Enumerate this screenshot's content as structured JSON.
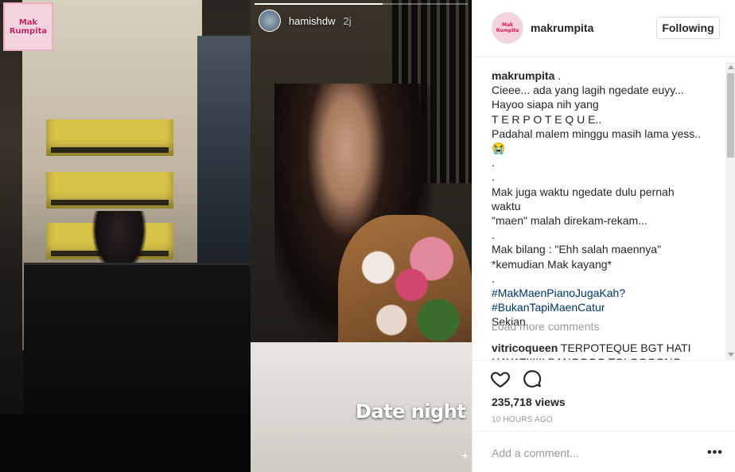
{
  "stories": {
    "logo_line1": "Mak",
    "logo_line2": "Rumpita",
    "story_username": "hamishdw",
    "story_time": "2j",
    "overlay_text": "Date night",
    "progress_fraction": 0.6,
    "plus_glyph": "+"
  },
  "post": {
    "header": {
      "username": "makrumpita",
      "follow_label": "Following"
    },
    "caption": {
      "author": "makrumpita",
      "lines": [
        ".",
        "Cieee... ada yang lagih ngedate euyy...",
        "Hayoo siapa nih yang",
        "T E R P O T E Q U E..",
        "Padahal malem minggu masih lama yess..",
        "😭",
        ".",
        ".",
        "Mak juga waktu ngedate dulu pernah waktu",
        "\"maen\" malah direkam-rekam...",
        ".",
        "Mak bilang : \"Ehh salah maennya\"",
        "*kemudian Mak kayang*",
        ".",
        "#MakMaenPianoJugaKah?",
        "#BukanTapiMaenCatur",
        "Sekian."
      ]
    },
    "load_more": "Load more comments",
    "comment": {
      "author": "vitricoqueen",
      "text": "TERPOTEQUE BGT HATI HAYATIIIIII BANGGGG TOLOOOONG BANG"
    },
    "views": "235,718 views",
    "time_ago": "10 HOURS AGO",
    "comment_placeholder": "Add a comment...",
    "more_options": "•••"
  },
  "colors": {
    "hashtag": "#003569",
    "muted": "#999999",
    "border": "#efefef",
    "text": "#262626"
  }
}
